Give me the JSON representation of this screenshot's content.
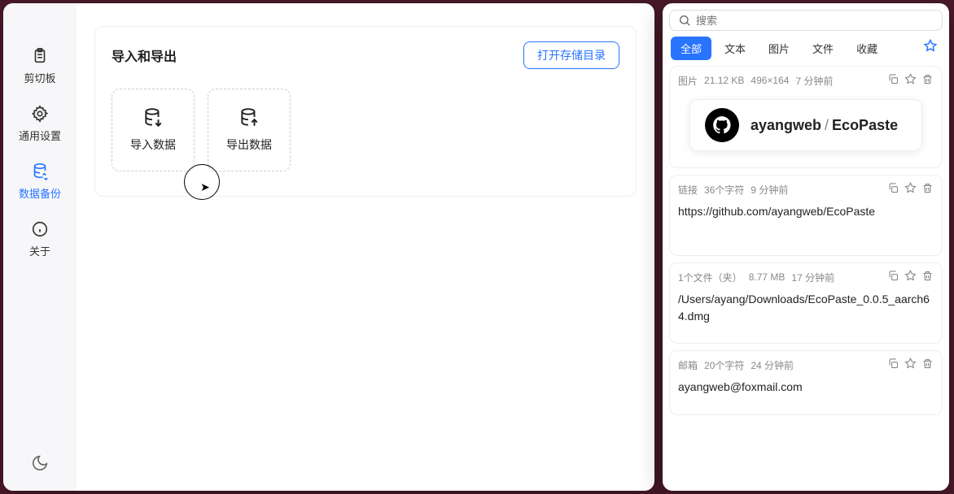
{
  "sidebar": {
    "items": [
      {
        "label": "剪切板"
      },
      {
        "label": "通用设置"
      },
      {
        "label": "数据备份"
      },
      {
        "label": "关于"
      }
    ]
  },
  "main": {
    "title": "导入和导出",
    "open_dir": "打开存储目录",
    "import": "导入数据",
    "export": "导出数据"
  },
  "search": {
    "placeholder": "搜索"
  },
  "tabs": [
    {
      "label": "全部"
    },
    {
      "label": "文本"
    },
    {
      "label": "图片"
    },
    {
      "label": "文件"
    },
    {
      "label": "收藏"
    }
  ],
  "clips": [
    {
      "type": "图片",
      "size": "21.12 KB",
      "dim": "496×164",
      "time": "7 分钟前",
      "preview": {
        "user": "ayangweb",
        "repo": "EcoPaste"
      }
    },
    {
      "type": "链接",
      "chars": "36个字符",
      "time": "9 分钟前",
      "body": "https://github.com/ayangweb/EcoPaste"
    },
    {
      "type": "1个文件（夹）",
      "size": "8.77 MB",
      "time": "17 分钟前",
      "body": "/Users/ayang/Downloads/EcoPaste_0.0.5_aarch64.dmg"
    },
    {
      "type": "邮箱",
      "chars": "20个字符",
      "time": "24 分钟前",
      "body": "ayangweb@foxmail.com"
    }
  ]
}
